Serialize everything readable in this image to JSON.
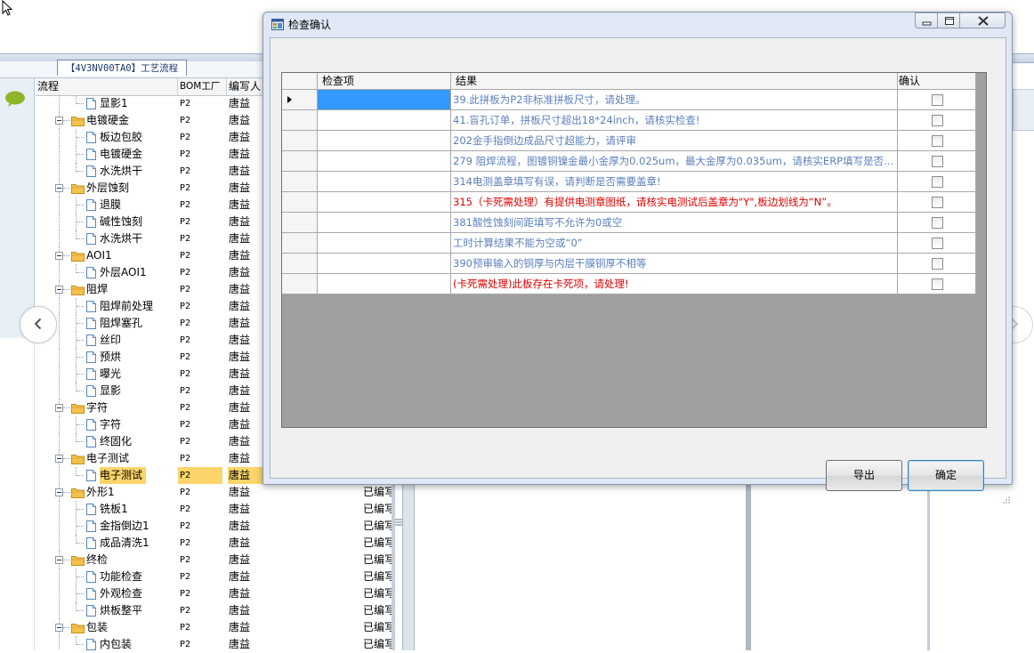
{
  "background_app": {
    "doc_tab": "【4V3NV00TA0】工艺流程",
    "tree_headers": {
      "flow": "流程",
      "bom_factory": "BOM工厂",
      "author": "编写人"
    },
    "tree_rows": [
      {
        "name": "显影1",
        "factory": "P2",
        "author": "唐益",
        "level": 2,
        "type": "leaf"
      },
      {
        "name": "电镀硬金",
        "factory": "P2",
        "author": "唐益",
        "level": 1,
        "type": "folder"
      },
      {
        "name": "板边包胶",
        "factory": "P2",
        "author": "唐益",
        "level": 2,
        "type": "leaf"
      },
      {
        "name": "电镀硬金",
        "factory": "P2",
        "author": "唐益",
        "level": 2,
        "type": "leaf"
      },
      {
        "name": "水洗烘干",
        "factory": "P2",
        "author": "唐益",
        "level": 2,
        "type": "leaf"
      },
      {
        "name": "外层蚀刻",
        "factory": "P2",
        "author": "唐益",
        "level": 1,
        "type": "folder"
      },
      {
        "name": "退膜",
        "factory": "P2",
        "author": "唐益",
        "level": 2,
        "type": "leaf"
      },
      {
        "name": "碱性蚀刻",
        "factory": "P2",
        "author": "唐益",
        "level": 2,
        "type": "leaf"
      },
      {
        "name": "水洗烘干",
        "factory": "P2",
        "author": "唐益",
        "level": 2,
        "type": "leaf"
      },
      {
        "name": "AOI1",
        "factory": "P2",
        "author": "唐益",
        "level": 1,
        "type": "folder"
      },
      {
        "name": "外层AOI1",
        "factory": "P2",
        "author": "唐益",
        "level": 2,
        "type": "leaf"
      },
      {
        "name": "阻焊",
        "factory": "P2",
        "author": "唐益",
        "level": 1,
        "type": "folder"
      },
      {
        "name": "阻焊前处理",
        "factory": "P2",
        "author": "唐益",
        "level": 2,
        "type": "leaf"
      },
      {
        "name": "阻焊塞孔",
        "factory": "P2",
        "author": "唐益",
        "level": 2,
        "type": "leaf"
      },
      {
        "name": "丝印",
        "factory": "P2",
        "author": "唐益",
        "level": 2,
        "type": "leaf"
      },
      {
        "name": "预烘",
        "factory": "P2",
        "author": "唐益",
        "level": 2,
        "type": "leaf"
      },
      {
        "name": "曝光",
        "factory": "P2",
        "author": "唐益",
        "level": 2,
        "type": "leaf"
      },
      {
        "name": "显影",
        "factory": "P2",
        "author": "唐益",
        "level": 2,
        "type": "leaf"
      },
      {
        "name": "字符",
        "factory": "P2",
        "author": "唐益",
        "level": 1,
        "type": "folder"
      },
      {
        "name": "字符",
        "factory": "P2",
        "author": "唐益",
        "level": 2,
        "type": "leaf"
      },
      {
        "name": "终固化",
        "factory": "P2",
        "author": "唐益",
        "level": 2,
        "type": "leaf"
      },
      {
        "name": "电子测试",
        "factory": "P2",
        "author": "唐益",
        "level": 1,
        "type": "folder"
      },
      {
        "name": "电子测试",
        "factory": "P2",
        "author": "唐益",
        "level": 2,
        "type": "leaf",
        "selected": true
      },
      {
        "name": "外形1",
        "factory": "P2",
        "author": "唐益",
        "level": 1,
        "type": "folder",
        "status": "已编写"
      },
      {
        "name": "铣板1",
        "factory": "P2",
        "author": "唐益",
        "level": 2,
        "type": "leaf",
        "status": "已编写"
      },
      {
        "name": "金指倒边1",
        "factory": "P2",
        "author": "唐益",
        "level": 2,
        "type": "leaf",
        "status": "已编写"
      },
      {
        "name": "成品清洗1",
        "factory": "P2",
        "author": "唐益",
        "level": 2,
        "type": "leaf",
        "status": "已编写"
      },
      {
        "name": "终检",
        "factory": "P2",
        "author": "唐益",
        "level": 1,
        "type": "folder",
        "status": "已编写"
      },
      {
        "name": "功能检查",
        "factory": "P2",
        "author": "唐益",
        "level": 2,
        "type": "leaf",
        "status": "已编写"
      },
      {
        "name": "外观检查",
        "factory": "P2",
        "author": "唐益",
        "level": 2,
        "type": "leaf",
        "status": "已编写"
      },
      {
        "name": "烘板整平",
        "factory": "P2",
        "author": "唐益",
        "level": 2,
        "type": "leaf",
        "status": "已编写"
      },
      {
        "name": "包装",
        "factory": "P2",
        "author": "唐益",
        "level": 1,
        "type": "folder",
        "status": "已编写"
      },
      {
        "name": "内包装",
        "factory": "P2",
        "author": "唐益",
        "level": 2,
        "type": "leaf",
        "status": "已编写"
      }
    ]
  },
  "dialog": {
    "title": "检查确认",
    "columns": {
      "check_item": "检查项",
      "result": "结果",
      "confirm": "确认"
    },
    "rows": [
      {
        "check_item": "",
        "result": "39.此拼板为P2非标准拼板尺寸，请处理。",
        "color": "blue",
        "confirmed": false,
        "current": true
      },
      {
        "check_item": "",
        "result": "41.盲孔订单，拼板尺寸超出18*24inch，请核实检查!",
        "color": "blue",
        "confirmed": false
      },
      {
        "check_item": "",
        "result": "202金手指倒边成品尺寸超能力，请评审",
        "color": "blue",
        "confirmed": false
      },
      {
        "check_item": "",
        "result": "279 阻焊流程，图镀铜镍金最小金厚为0.025um，最大金厚为0.035um，请核实ERP填写是否...",
        "color": "blue",
        "confirmed": false
      },
      {
        "check_item": "",
        "result": "314电测盖章填写有误，请判断是否需要盖章!",
        "color": "blue",
        "confirmed": false
      },
      {
        "check_item": "",
        "result": "315（卡死需处理）有提供电测章图纸，请核实电测试后盖章为\"Y\",板边划线为“N”。",
        "color": "red",
        "confirmed": false
      },
      {
        "check_item": "",
        "result": "381酸性蚀刻间距填写不允许为0或空",
        "color": "blue",
        "confirmed": false
      },
      {
        "check_item": "",
        "result": "工时计算结果不能为空或“0”",
        "color": "blue",
        "confirmed": false
      },
      {
        "check_item": "",
        "result": "390预审输入的铜厚与内层干膜铜厚不相等",
        "color": "blue",
        "confirmed": false
      },
      {
        "check_item": "",
        "result": "(卡死需处理)此板存在卡死项，请处理!",
        "color": "red",
        "confirmed": false
      }
    ],
    "buttons": {
      "export": "导出",
      "ok": "确定"
    }
  },
  "colors": {
    "blue_text": "#5b7fbc",
    "red_text": "#e00000",
    "selection": "#3399ff",
    "tree_selection": "#fbd56a"
  }
}
